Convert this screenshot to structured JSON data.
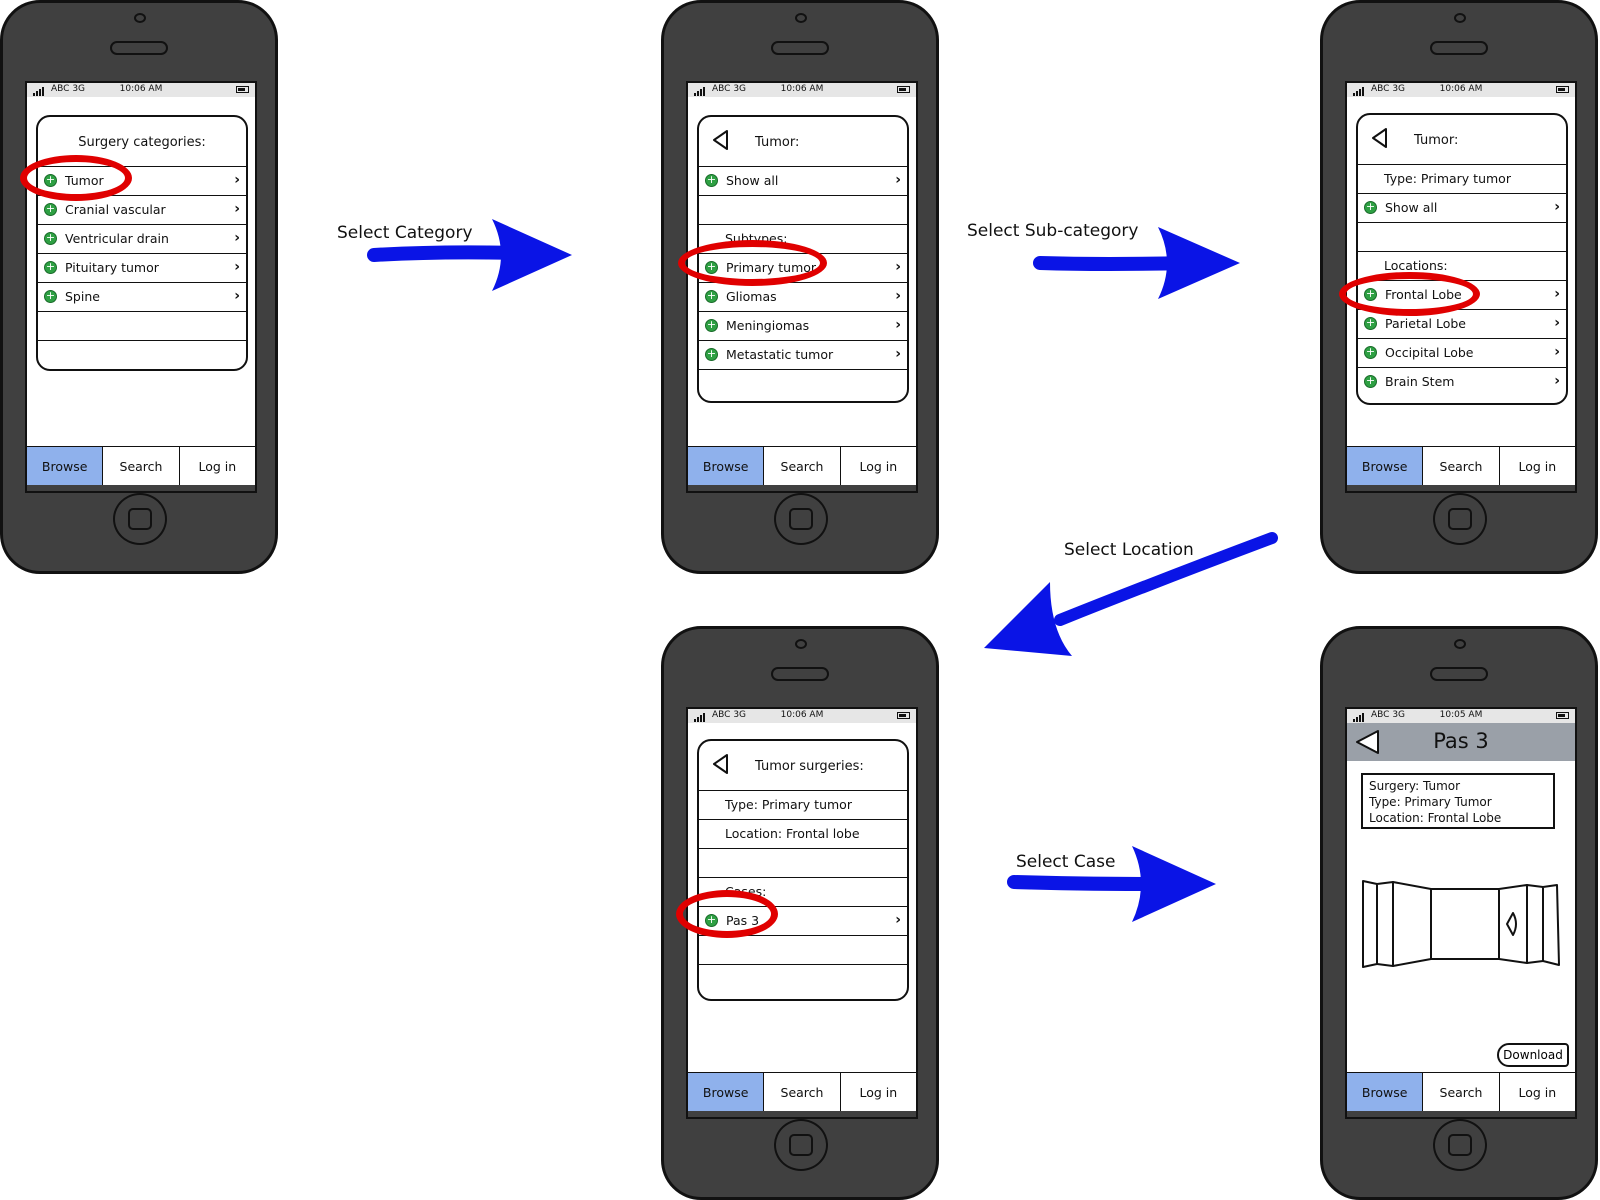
{
  "status": {
    "carrier": "ABC 3G",
    "time": "10:06 AM",
    "time_detail": "10:05 AM"
  },
  "tabs": [
    "Browse",
    "Search",
    "Log in"
  ],
  "screens": {
    "categories": {
      "title": "Surgery categories:",
      "items": [
        "Tumor",
        "Cranial vascular",
        "Ventricular drain",
        "Pituitary tumor",
        "Spine"
      ]
    },
    "subcategory": {
      "title": "Tumor:",
      "show_all": "Show all",
      "section": "Subtypes:",
      "items": [
        "Primary tumor",
        "Gliomas",
        "Meningiomas",
        "Metastatic tumor"
      ]
    },
    "location": {
      "title": "Tumor:",
      "type_line": "Type: Primary tumor",
      "show_all": "Show all",
      "section": "Locations:",
      "items": [
        "Frontal Lobe",
        "Parietal Lobe",
        "Occipital Lobe",
        "Brain Stem"
      ]
    },
    "cases": {
      "title": "Tumor surgeries:",
      "type_line": "Type: Primary tumor",
      "location_line": "Location: Frontal lobe",
      "section": "Cases:",
      "items": [
        "Pas 3"
      ]
    },
    "detail": {
      "title": "Pas 3",
      "info": [
        "Surgery: Tumor",
        "Type: Primary Tumor",
        "Location: Frontal Lobe"
      ],
      "download": "Download"
    }
  },
  "arrows": [
    "Select Category",
    "Select Sub-category",
    "Select Location",
    "Select Case"
  ],
  "colors": {
    "arrow": "#0a14e6",
    "highlight": "#e00000",
    "active_tab": "#8fb1ec",
    "phone": "#404040"
  }
}
